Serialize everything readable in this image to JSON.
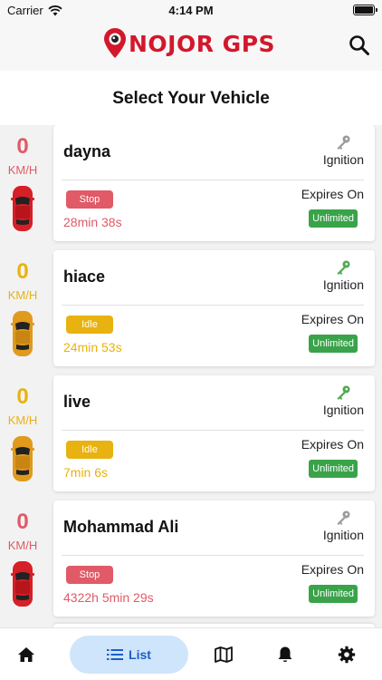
{
  "status_bar": {
    "carrier": "Carrier",
    "time": "4:14 PM"
  },
  "header": {
    "brand": "NOJOR GPS"
  },
  "page": {
    "title": "Select Your Vehicle"
  },
  "colors": {
    "brand_red": "#d3182c",
    "stop_red": "#e05a67",
    "idle_amber": "#e8b210",
    "key_green": "#4caa4f",
    "key_gray": "#9a9a9a",
    "unlimited_green": "#3aa34a",
    "tab_active": "#1a5fc8"
  },
  "vehicles": [
    {
      "speed": "0",
      "unit": "KM/H",
      "name": "dayna",
      "ignition_label": "Ignition",
      "status": "Stop",
      "duration": "28min 38s",
      "expires_label": "Expires On",
      "expiry": "Unlimited",
      "state": "stop",
      "car_icon": "red-car-icon",
      "key_icon": "key-gray-icon"
    },
    {
      "speed": "0",
      "unit": "KM/H",
      "name": "hiace",
      "ignition_label": "Ignition",
      "status": "Idle",
      "duration": "24min 53s",
      "expires_label": "Expires On",
      "expiry": "Unlimited",
      "state": "idle",
      "car_icon": "orange-car-icon",
      "key_icon": "key-green-icon"
    },
    {
      "speed": "0",
      "unit": "KM/H",
      "name": "live",
      "ignition_label": "Ignition",
      "status": "Idle",
      "duration": "7min 6s",
      "expires_label": "Expires On",
      "expiry": "Unlimited",
      "state": "idle",
      "car_icon": "orange-car-icon",
      "key_icon": "key-green-icon"
    },
    {
      "speed": "0",
      "unit": "KM/H",
      "name": "Mohammad Ali",
      "ignition_label": "Ignition",
      "status": "Stop",
      "duration": "4322h 5min 29s",
      "expires_label": "Expires On",
      "expiry": "Unlimited",
      "state": "stop",
      "car_icon": "red-car-icon",
      "key_icon": "key-gray-icon"
    }
  ],
  "tabbar": {
    "list_label": "List",
    "icons": [
      "home-icon",
      "list-icon",
      "map-icon",
      "bell-icon",
      "settings-icon"
    ]
  }
}
